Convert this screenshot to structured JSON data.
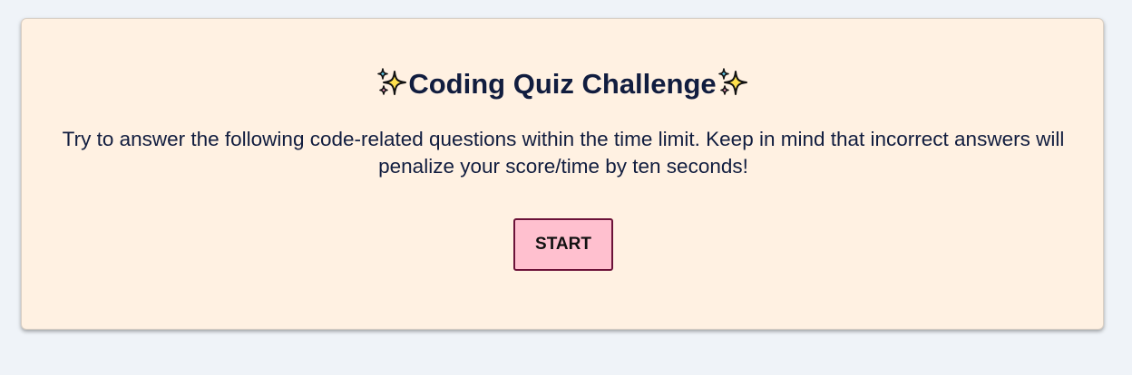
{
  "quiz": {
    "title": "Coding Quiz Challenge",
    "description": "Try to answer the following code-related questions within the time limit. Keep in mind that incorrect answers will penalize your score/time by ten seconds!",
    "start_label": "START"
  },
  "icons": {
    "title_left": "sparkles-icon",
    "title_right": "sparkles-icon"
  },
  "colors": {
    "page_background": "#eff3f8",
    "card_background": "#fff1e2",
    "text": "#111d3f",
    "button_background": "#ffc0cf",
    "button_border": "#6b1238",
    "sparkle_yellow": "#ffe14d",
    "sparkle_blue": "#5fc8e6",
    "sparkle_pink": "#f59ac0"
  }
}
